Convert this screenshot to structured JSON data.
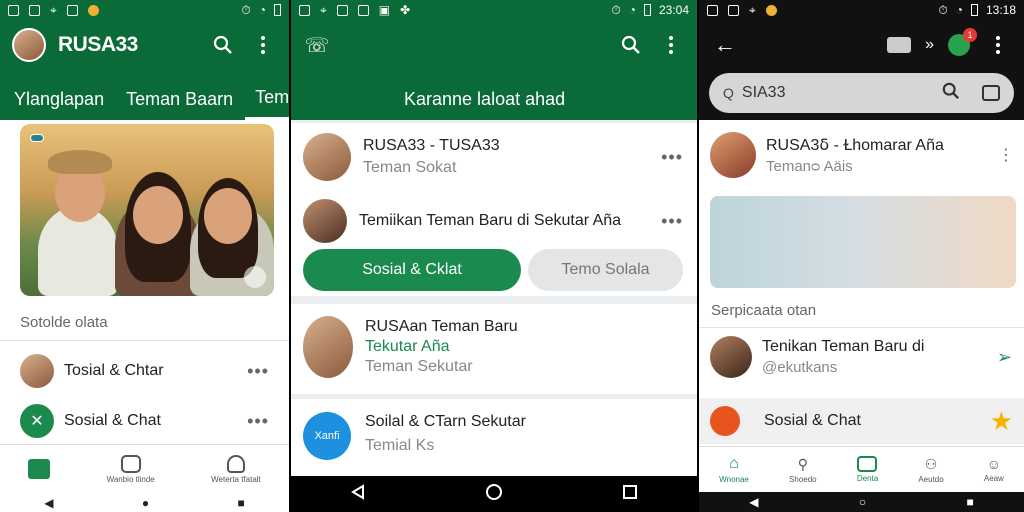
{
  "panel1": {
    "status": {
      "time": ""
    },
    "appbar": {
      "title": "RUSA33",
      "tabs": [
        "Ylanglapan",
        "Teman Baarn",
        "TemolKanoghann"
      ]
    },
    "photo": {
      "badge": ""
    },
    "section_label": "Sotolde olata",
    "list": [
      {
        "label": "Tosial & Chtar"
      },
      {
        "label": "Sosial & Chat"
      }
    ],
    "nav": [
      "",
      "Wanbio tlinde",
      "Weterta tfatalt"
    ]
  },
  "panel2": {
    "status": {
      "time": "23:04"
    },
    "appbar": {
      "tabs": [
        "Karanne laloat ahad"
      ]
    },
    "card1": {
      "contact_title": "RUSA33 - TUSA33",
      "contact_sub": "Teman Sokat",
      "promo_text": "Temiikan Teman Baru di Sekutar Aña",
      "btn_primary": "Sosial & Cklat",
      "btn_secondary": "Temo Solala"
    },
    "card2": {
      "title": "RUSAan Teman Baru",
      "highlight": "Tekutar Aña",
      "sub": "Teman Sekutar"
    },
    "card3": {
      "avatar_text": "Xanfi",
      "title": "Soilal & CTarn Sekutar",
      "sub": "Temial Ks"
    }
  },
  "panel3": {
    "status": {
      "time": "13:18"
    },
    "notif_count": "1",
    "search": {
      "value": "SIA33"
    },
    "contact": {
      "title": "RUSA3ẟ - Ɫhomarar Aña",
      "sub": "Temanᴑ Aäis"
    },
    "section_label": "Serpicaata otan",
    "row1": {
      "title": "Tenikan Teman Baru di",
      "sub": "@ekutkans"
    },
    "row2": {
      "label": "Sosial & Chat"
    },
    "nav": [
      "Wnonae",
      "Shoedo",
      "Denta",
      "Aeutdo",
      "Aeaw"
    ]
  },
  "colors": {
    "primary": "#0a6a38",
    "accent": "#1b8a4f",
    "highlight": "#1b8a4f"
  }
}
